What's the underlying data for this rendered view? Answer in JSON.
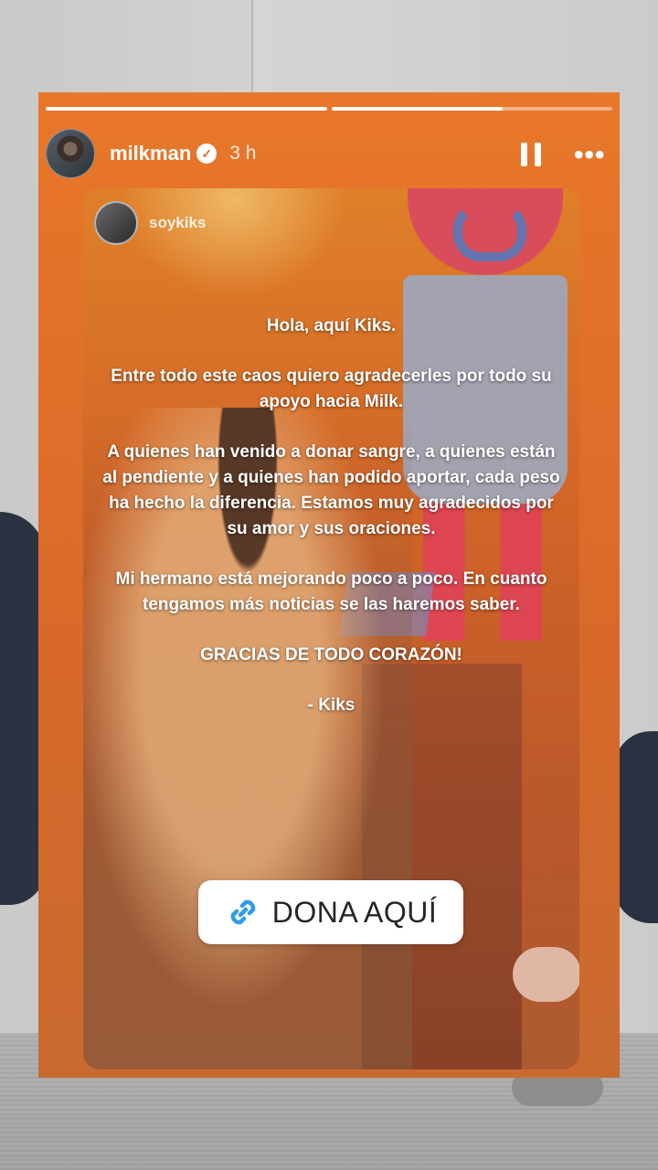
{
  "story": {
    "progress": [
      1.0,
      0.61
    ],
    "username": "milkman",
    "time": "3 h",
    "icons": {
      "verified": "verified-badge-icon",
      "pause": "pause-icon",
      "more": "more-options-icon"
    }
  },
  "shared_post": {
    "username": "soykiks",
    "paragraphs": [
      "Hola, aquí Kiks.",
      "Entre todo este caos quiero agradecerles por todo su apoyo hacia Milk.",
      "A quienes han venido a donar sangre, a quienes están al pendiente y a quienes han podido aportar, cada peso ha hecho la diferencia. Estamos muy agradecidos por su amor y sus oraciones.",
      "Mi hermano está mejorando poco a poco. En cuanto tengamos más noticias se las haremos saber.",
      "GRACIAS DE TODO CORAZÓN!",
      "- Kiks"
    ]
  },
  "link_sticker": {
    "label": "DONA AQUÍ",
    "icon": "link-icon",
    "accent": "#2d9cf0"
  }
}
